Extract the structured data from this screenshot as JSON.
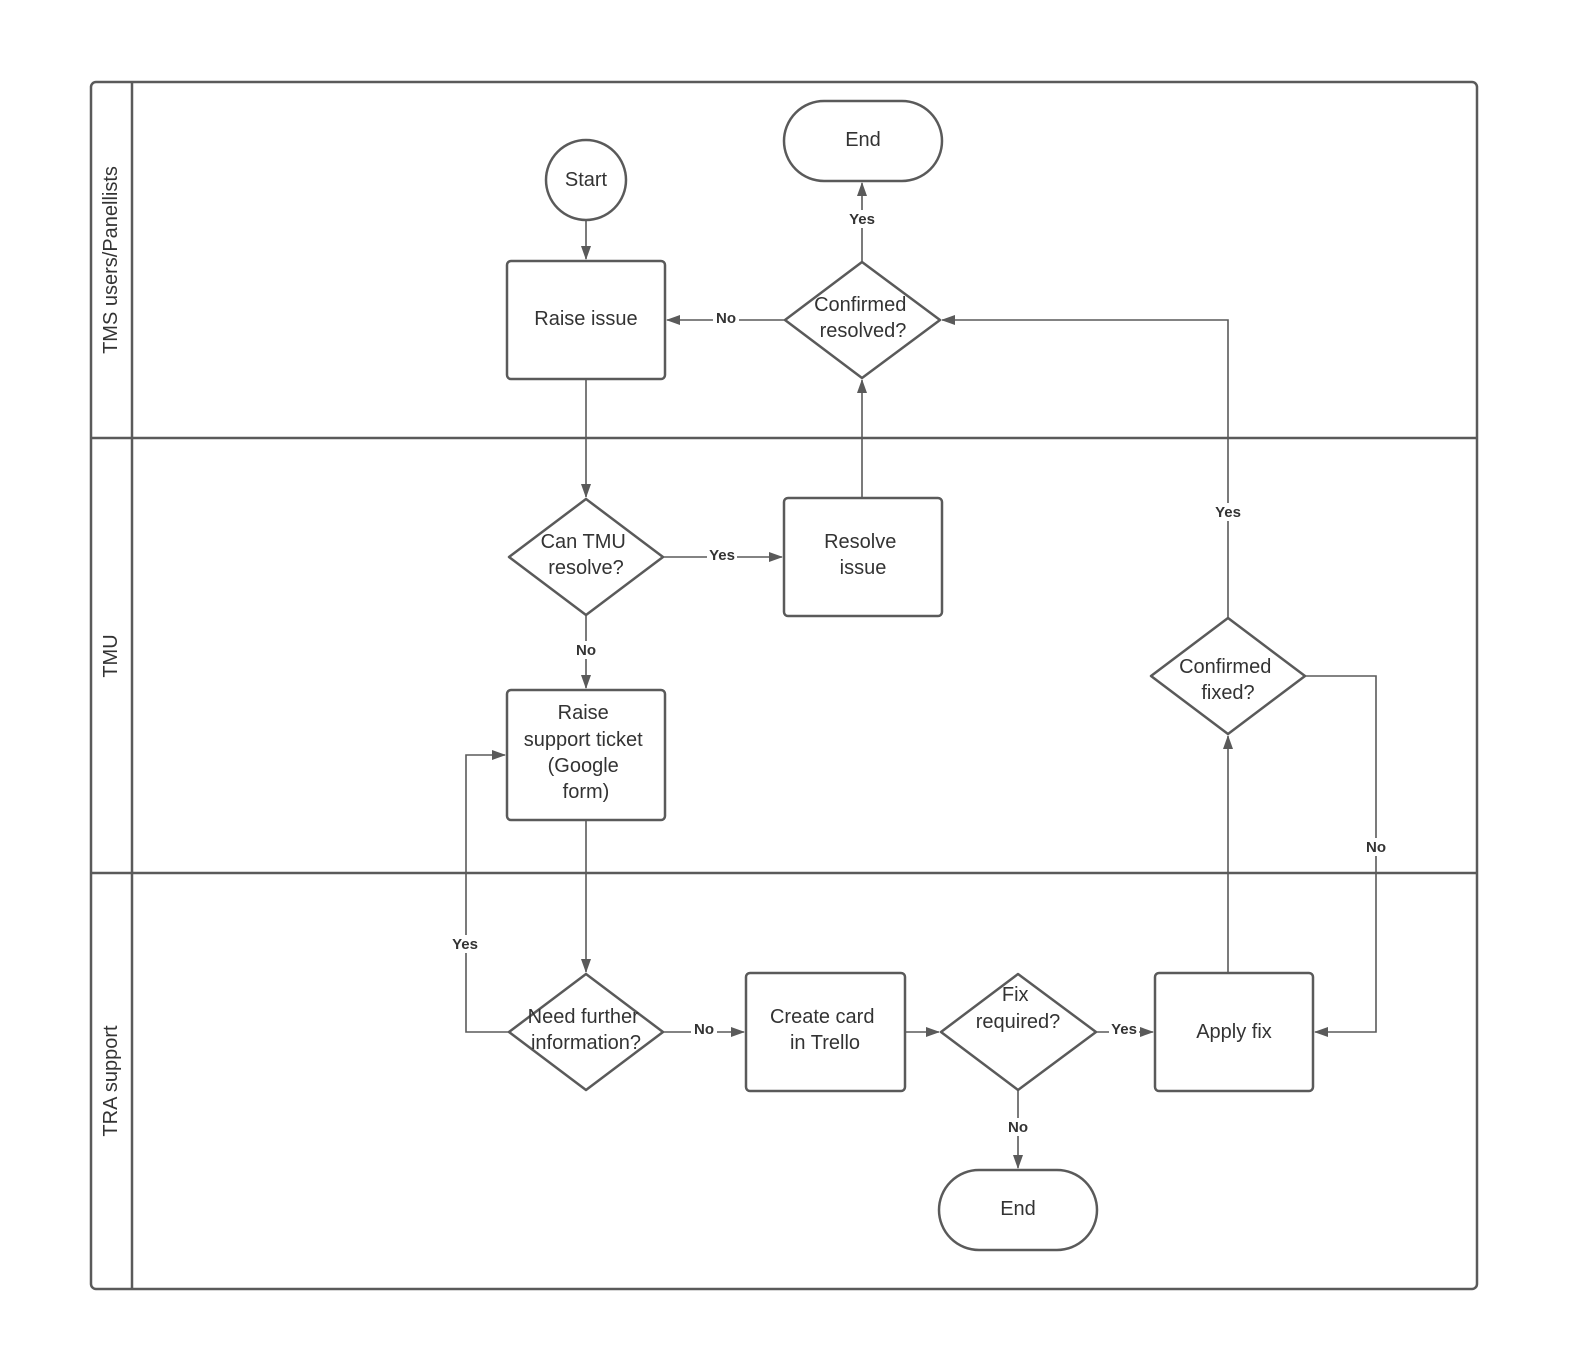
{
  "lanes": [
    "TMS users/Panellists",
    "TMU",
    "TRA support"
  ],
  "nodes": {
    "start": [
      "Start"
    ],
    "end_top": [
      "End"
    ],
    "raise_issue": [
      "Raise issue"
    ],
    "confirmed_resolved": [
      "Confirmed",
      "resolved?"
    ],
    "can_tmu_resolve": [
      "Can TMU",
      "resolve?"
    ],
    "resolve_issue": [
      "Resolve",
      "issue"
    ],
    "raise_ticket": [
      "Raise",
      "support ticket",
      "(Google",
      "form)"
    ],
    "confirmed_fixed": [
      "Confirmed",
      "fixed?"
    ],
    "need_info": [
      "Need further",
      "information?"
    ],
    "create_card": [
      "Create card",
      "in Trello"
    ],
    "fix_required": [
      "Fix",
      "required?"
    ],
    "apply_fix": [
      "Apply fix"
    ],
    "end_bottom": [
      "End"
    ]
  },
  "edge_labels": {
    "confirmed_yes": "Yes",
    "confirmed_no": "No",
    "can_tmu_yes": "Yes",
    "can_tmu_no": "No",
    "need_info_yes": "Yes",
    "need_info_no": "No",
    "fix_yes": "Yes",
    "fix_no": "No",
    "fixed_yes": "Yes",
    "fixed_no": "No"
  },
  "colors": {
    "stroke": "#5a5a5a",
    "text": "#333333"
  }
}
